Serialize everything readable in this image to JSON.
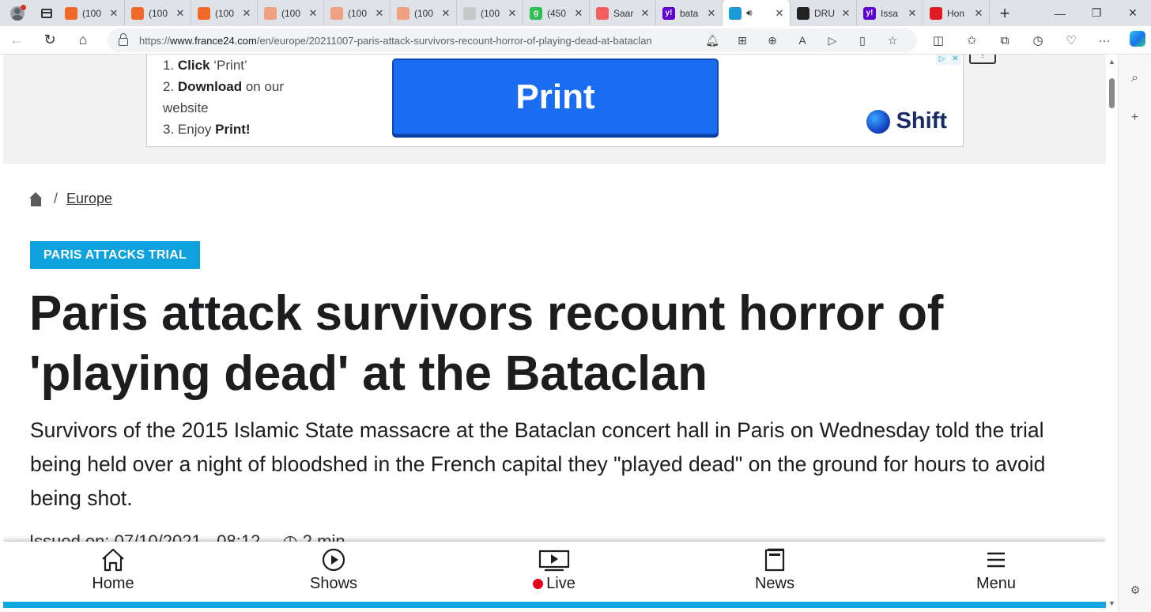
{
  "browser": {
    "tabs": [
      {
        "title": "(100",
        "icon": "bookmark-icon",
        "color": "#f0692a"
      },
      {
        "title": "(100",
        "icon": "bookmark-icon",
        "color": "#f0692a"
      },
      {
        "title": "(100",
        "icon": "bookmark-icon",
        "color": "#f0692a"
      },
      {
        "title": "(100",
        "icon": "bookmark-icon",
        "color": "#f0a080"
      },
      {
        "title": "(100",
        "icon": "bookmark-icon",
        "color": "#f0a080"
      },
      {
        "title": "(100",
        "icon": "bookmark-icon",
        "color": "#f0a080"
      },
      {
        "title": "(100",
        "icon": "image-icon",
        "color": "#c8c8c8"
      },
      {
        "title": "(450",
        "icon": "g-icon",
        "color": "#2fbf55",
        "glyph": "g"
      },
      {
        "title": "Saar",
        "icon": "youtube-icon",
        "color": "#f06060"
      },
      {
        "title": "bata",
        "icon": "yahoo-icon",
        "color": "#5f01d1",
        "glyph": "y!"
      },
      {
        "title": "",
        "icon": "france24-icon",
        "color": "#1a9ad6",
        "active": true
      },
      {
        "title": "DRU",
        "icon": "drudge-icon",
        "color": "#222222"
      },
      {
        "title": "Issa",
        "icon": "yahoo-icon",
        "color": "#5f01d1",
        "glyph": "y!"
      },
      {
        "title": "Hon",
        "icon": "news-icon",
        "color": "#e01b24"
      }
    ],
    "url_prefix": "https://",
    "url_host": "www.france24.com",
    "url_path": "/en/europe/20211007-paris-attack-survivors-recount-horror-of-playing-dead-at-bataclan"
  },
  "ad": {
    "step1_num": "1. ",
    "step1_bold": "Click",
    "step1_rest": " ‘Print’",
    "step2_num": "2. ",
    "step2_bold": "Download",
    "step2_rest": " on our",
    "step2_line2": "website",
    "step3_num": "3. Enjoy ",
    "step3_bold": "Print!",
    "button_label": "Print",
    "brand": "Shift"
  },
  "breadcrumb": {
    "section": "Europe"
  },
  "article": {
    "tag": "PARIS ATTACKS TRIAL",
    "headline": "Paris attack survivors recount horror of 'playing dead' at the Bataclan",
    "lede": "Survivors of the 2015 Islamic State massacre at the Bataclan concert hall in Paris on Wednesday told the trial being held over a night of bloodshed in the French capital they \"played dead\" on the ground for hours to avoid being shot.",
    "issued": "Issued on: 07/10/2021 - 08:12",
    "read_time": "2 min"
  },
  "bottom_nav": {
    "home": "Home",
    "shows": "Shows",
    "live": "Live",
    "news": "News",
    "menu": "Menu"
  },
  "colors": {
    "tag_bg": "#0da2de",
    "live_dot": "#e4001b",
    "ad_button": "#1a6cf0"
  }
}
